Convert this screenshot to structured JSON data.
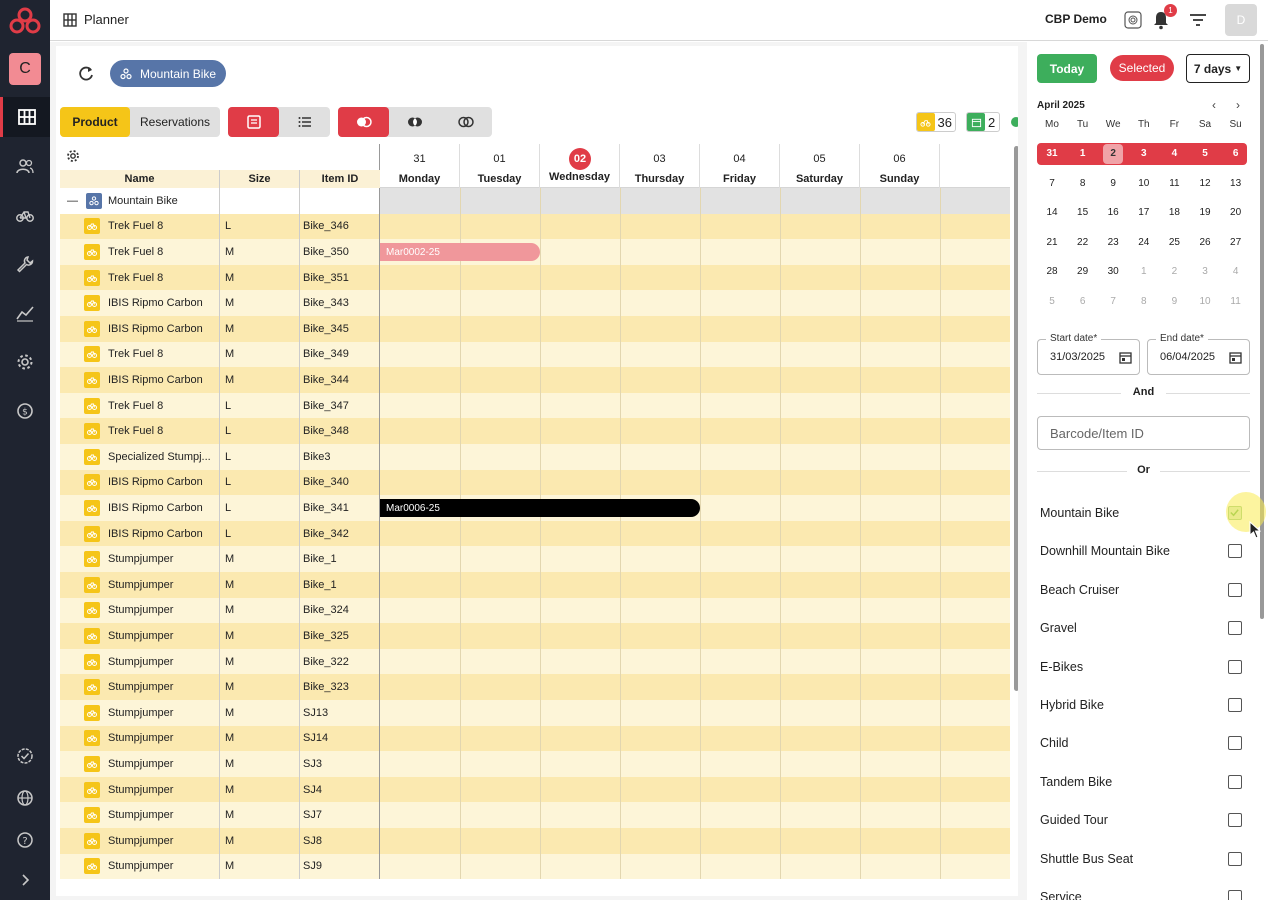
{
  "sidebar": {
    "user_initial": "C",
    "icons": [
      "grid-icon",
      "users-icon",
      "bike-icon",
      "wrench-icon",
      "chart-icon",
      "settings-icon",
      "history-icon",
      "check-badge-icon",
      "globe-icon",
      "help-icon",
      "expand-icon"
    ]
  },
  "topbar": {
    "title": "Planner",
    "company": "CBP Demo",
    "notification_count": "1",
    "avatar_initial": "D"
  },
  "filter_chip": {
    "label": "Mountain Bike"
  },
  "toolbar": {
    "product_label": "Product",
    "reservations_label": "Reservations"
  },
  "counters": {
    "available": "36",
    "booked": "2"
  },
  "grid": {
    "columns": {
      "name": "Name",
      "size": "Size",
      "item_id": "Item ID"
    },
    "days": [
      {
        "num": "31",
        "name": "Monday",
        "today": false
      },
      {
        "num": "01",
        "name": "Tuesday",
        "today": false
      },
      {
        "num": "02",
        "name": "Wednesday",
        "today": true
      },
      {
        "num": "03",
        "name": "Thursday",
        "today": false
      },
      {
        "num": "04",
        "name": "Friday",
        "today": false
      },
      {
        "num": "05",
        "name": "Saturday",
        "today": false
      },
      {
        "num": "06",
        "name": "Sunday",
        "today": false
      }
    ],
    "group_label": "Mountain Bike",
    "rows": [
      {
        "name": "Trek Fuel 8",
        "size": "L",
        "item": "Bike_346"
      },
      {
        "name": "Trek Fuel 8",
        "size": "M",
        "item": "Bike_350"
      },
      {
        "name": "Trek Fuel 8",
        "size": "M",
        "item": "Bike_351"
      },
      {
        "name": "IBIS Ripmo Carbon",
        "size": "M",
        "item": "Bike_343"
      },
      {
        "name": "IBIS Ripmo Carbon",
        "size": "M",
        "item": "Bike_345"
      },
      {
        "name": "Trek Fuel 8",
        "size": "M",
        "item": "Bike_349"
      },
      {
        "name": "IBIS Ripmo Carbon",
        "size": "M",
        "item": "Bike_344"
      },
      {
        "name": "Trek Fuel 8",
        "size": "L",
        "item": "Bike_347"
      },
      {
        "name": "Trek Fuel 8",
        "size": "L",
        "item": "Bike_348"
      },
      {
        "name": "Specialized Stumpj...",
        "size": "L",
        "item": "Bike3"
      },
      {
        "name": "IBIS Ripmo Carbon",
        "size": "L",
        "item": "Bike_340"
      },
      {
        "name": "IBIS Ripmo Carbon",
        "size": "L",
        "item": "Bike_341"
      },
      {
        "name": "IBIS Ripmo Carbon",
        "size": "L",
        "item": "Bike_342"
      },
      {
        "name": "Stumpjumper",
        "size": "M",
        "item": "Bike_1"
      },
      {
        "name": "Stumpjumper",
        "size": "M",
        "item": "Bike_1"
      },
      {
        "name": "Stumpjumper",
        "size": "M",
        "item": "Bike_324"
      },
      {
        "name": "Stumpjumper",
        "size": "M",
        "item": "Bike_325"
      },
      {
        "name": "Stumpjumper",
        "size": "M",
        "item": "Bike_322"
      },
      {
        "name": "Stumpjumper",
        "size": "M",
        "item": "Bike_323"
      },
      {
        "name": "Stumpjumper",
        "size": "M",
        "item": "SJ13"
      },
      {
        "name": "Stumpjumper",
        "size": "M",
        "item": "SJ14"
      },
      {
        "name": "Stumpjumper",
        "size": "M",
        "item": "SJ3"
      },
      {
        "name": "Stumpjumper",
        "size": "M",
        "item": "SJ4"
      },
      {
        "name": "Stumpjumper",
        "size": "M",
        "item": "SJ7"
      },
      {
        "name": "Stumpjumper",
        "size": "M",
        "item": "SJ8"
      },
      {
        "name": "Stumpjumper",
        "size": "M",
        "item": "SJ9"
      }
    ],
    "reservations": [
      {
        "label": "Mar0002-25",
        "row": 1,
        "start_day": 0,
        "span_days": 2,
        "color": "#f0979b"
      },
      {
        "label": "Mar0006-25",
        "row": 11,
        "start_day": 0,
        "span_days": 4,
        "color": "#000000"
      }
    ]
  },
  "calendar": {
    "today_label": "Today",
    "selected_label": "Selected",
    "range_label": "7 days",
    "month": "April 2025",
    "weekdays": [
      "Mo",
      "Tu",
      "We",
      "Th",
      "Fr",
      "Sa",
      "Su"
    ],
    "weeks": [
      [
        "31",
        "1",
        "2",
        "3",
        "4",
        "5",
        "6"
      ],
      [
        "7",
        "8",
        "9",
        "10",
        "11",
        "12",
        "13"
      ],
      [
        "14",
        "15",
        "16",
        "17",
        "18",
        "19",
        "20"
      ],
      [
        "21",
        "22",
        "23",
        "24",
        "25",
        "26",
        "27"
      ],
      [
        "28",
        "29",
        "30",
        "1",
        "2",
        "3",
        "4"
      ],
      [
        "5",
        "6",
        "7",
        "8",
        "9",
        "10",
        "11"
      ]
    ],
    "selected_week": 0,
    "today_day": "2",
    "other_month_from": [
      4,
      3
    ]
  },
  "filters": {
    "start_date_label": "Start date*",
    "start_date": "31/03/2025",
    "end_date_label": "End date*",
    "end_date": "06/04/2025",
    "and_label": "And",
    "barcode_placeholder": "Barcode/Item ID",
    "or_label": "Or",
    "categories": [
      {
        "label": "Mountain Bike",
        "checked": true
      },
      {
        "label": "Downhill Mountain Bike",
        "checked": false
      },
      {
        "label": "Beach Cruiser",
        "checked": false
      },
      {
        "label": "Gravel",
        "checked": false
      },
      {
        "label": "E-Bikes",
        "checked": false
      },
      {
        "label": "Hybrid Bike",
        "checked": false
      },
      {
        "label": "Child",
        "checked": false
      },
      {
        "label": "Tandem Bike",
        "checked": false
      },
      {
        "label": "Guided Tour",
        "checked": false
      },
      {
        "label": "Shuttle Bus Seat",
        "checked": false
      },
      {
        "label": "Service",
        "checked": false
      }
    ]
  },
  "colors": {
    "accent_red": "#e03c47",
    "accent_yellow": "#f5c518",
    "accent_green": "#3dae5c",
    "row_even": "#fdf5d8",
    "row_odd": "#fbe9b0"
  }
}
